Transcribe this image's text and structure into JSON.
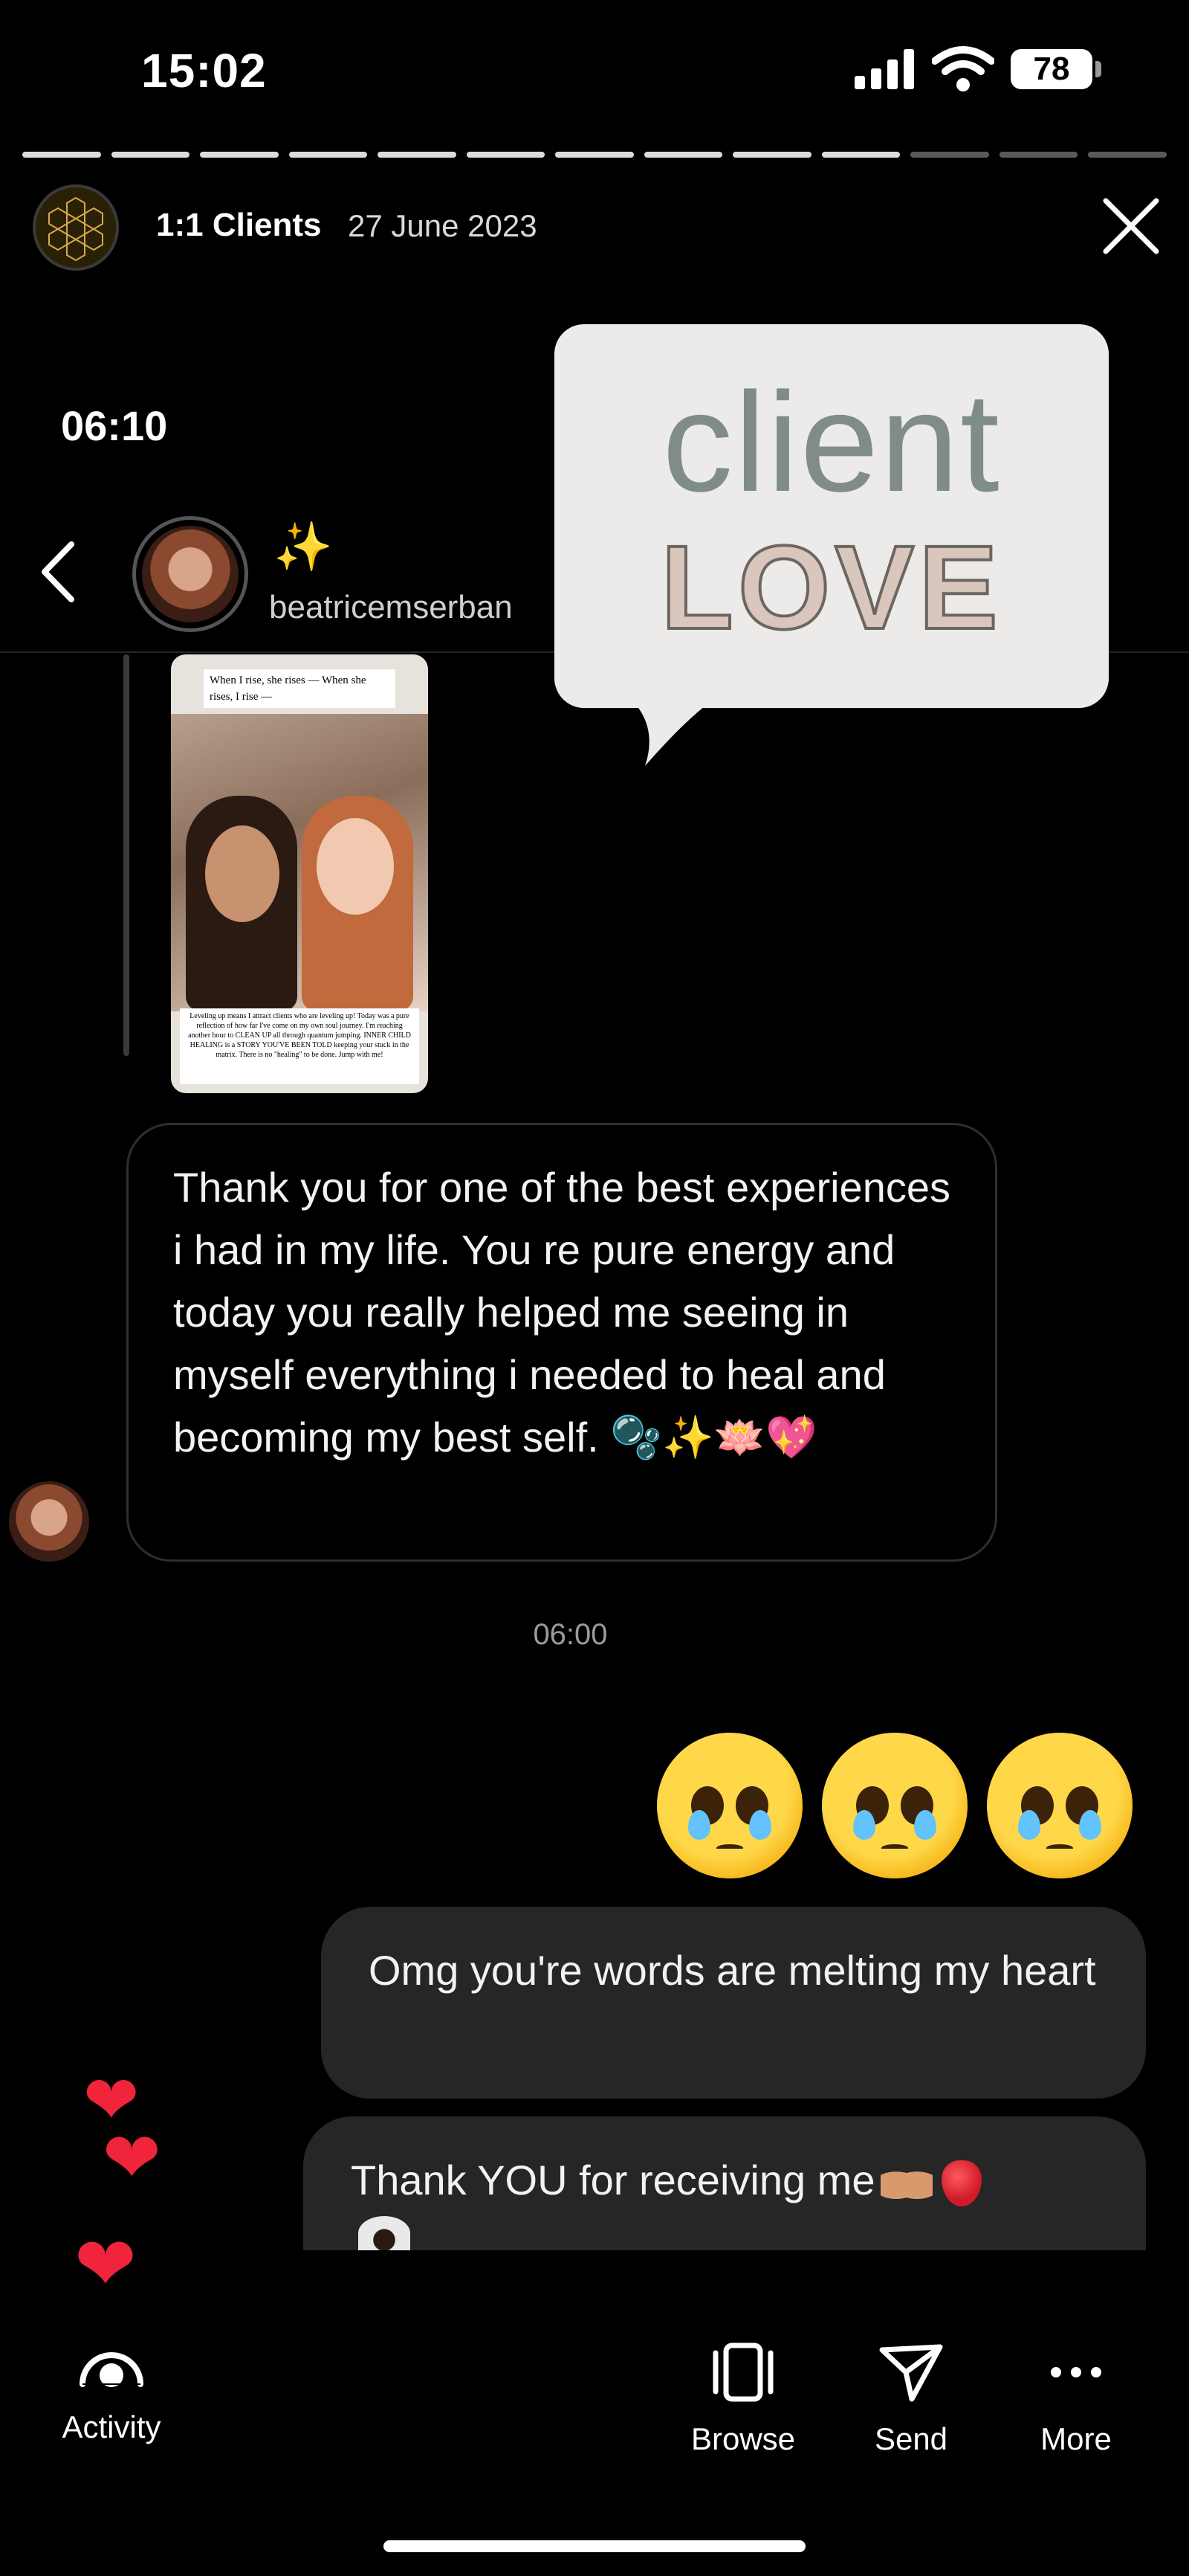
{
  "status_bar": {
    "time": "15:02",
    "battery": "78"
  },
  "story": {
    "progress": {
      "total_segments": 13,
      "completed_segments": 10
    },
    "username": "1:1 Clients",
    "date": "27 June 2023"
  },
  "sticker": {
    "line1": "client",
    "line2": "LOVE"
  },
  "inner_screenshot": {
    "time": "06:10",
    "contact_name": "beatricemserban",
    "sparkles": "✨",
    "thumbnail": {
      "top_caption": "When I rise, she rises — When she rises, I rise —",
      "bottom_caption": "Leveling up means I attract clients who are leveling up! Today was a pure reflection of how far I've come on my own soul journey. I'm reaching another hour to CLEAN UP all through quantum jumping. INNER CHILD HEALING is a STORY YOU'VE BEEN TOLD keeping your stuck in the matrix. There is no \"healing\" to be done. Jump with me!"
    },
    "messages": {
      "incoming_text": "Thank you for one of the best experiences i had in my life. You re pure energy and today you really helped me seeing in myself everything i needed to heal and becoming my best self. 🫧✨🪷💖",
      "timestamp": "06:00",
      "emoji_reactions": [
        "🥺",
        "🥺",
        "🥺"
      ],
      "outgoing_1": "Omg you're words are melting my heart",
      "outgoing_2": "Thank YOU for receiving me"
    },
    "hearts": [
      "❤",
      "❤",
      "❤"
    ]
  },
  "bottom_bar": {
    "activity": "Activity",
    "browse": "Browse",
    "send": "Send",
    "more": "More"
  }
}
